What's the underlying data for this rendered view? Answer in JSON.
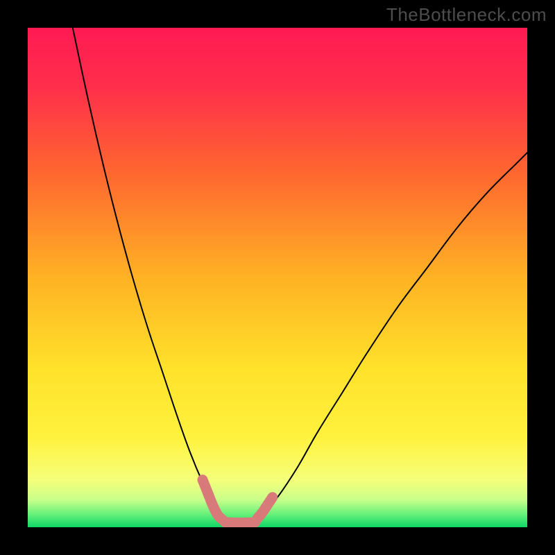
{
  "watermark": "TheBottleneck.com",
  "chart_data": {
    "type": "line",
    "title": "",
    "xlabel": "",
    "ylabel": "",
    "xlim": [
      0,
      100
    ],
    "ylim": [
      0,
      100
    ],
    "grid": false,
    "legend": false,
    "series": [
      {
        "name": "curve-left",
        "x": [
          9,
          12,
          15,
          18,
          21,
          24,
          27,
          30,
          32.5,
          35,
          37,
          38.5,
          40
        ],
        "values": [
          100,
          86,
          73,
          61,
          50,
          40,
          31,
          22,
          15,
          9,
          5,
          2.5,
          0.8
        ]
      },
      {
        "name": "curve-right",
        "x": [
          45,
          47,
          50,
          54,
          58,
          63,
          68,
          74,
          80,
          86,
          92,
          98,
          100
        ],
        "values": [
          0.8,
          2.5,
          6,
          12,
          19,
          27,
          35,
          44,
          52,
          60,
          67,
          73,
          75
        ]
      }
    ],
    "highlight_band": {
      "y_from": 0,
      "y_to": 18,
      "description": "pale-yellow-to-green gradient band near bottom"
    },
    "marker_segments": [
      {
        "name": "left-marker",
        "points": [
          [
            35,
            9.5
          ],
          [
            36,
            7
          ],
          [
            37,
            4.5
          ],
          [
            38,
            2.5
          ],
          [
            39,
            1.5
          ]
        ]
      },
      {
        "name": "bottom-marker",
        "points": [
          [
            39.5,
            1.0
          ],
          [
            41.5,
            0.9
          ],
          [
            43.5,
            0.9
          ],
          [
            45.5,
            1.0
          ]
        ]
      },
      {
        "name": "right-marker",
        "points": [
          [
            46,
            1.8
          ],
          [
            47,
            3.0
          ],
          [
            48,
            4.5
          ],
          [
            49,
            6.0
          ]
        ]
      }
    ],
    "background": {
      "type": "vertical-gradient",
      "stops": [
        {
          "pos": 0.0,
          "color": "#ff1a53"
        },
        {
          "pos": 0.12,
          "color": "#ff2f4a"
        },
        {
          "pos": 0.3,
          "color": "#ff6a2f"
        },
        {
          "pos": 0.5,
          "color": "#ffb224"
        },
        {
          "pos": 0.68,
          "color": "#ffe12a"
        },
        {
          "pos": 0.82,
          "color": "#fff23e"
        },
        {
          "pos": 0.905,
          "color": "#f5ff7a"
        },
        {
          "pos": 0.945,
          "color": "#c9ff8a"
        },
        {
          "pos": 0.975,
          "color": "#63f07a"
        },
        {
          "pos": 1.0,
          "color": "#0fd666"
        }
      ]
    },
    "marker_color": "#d97a7a"
  }
}
